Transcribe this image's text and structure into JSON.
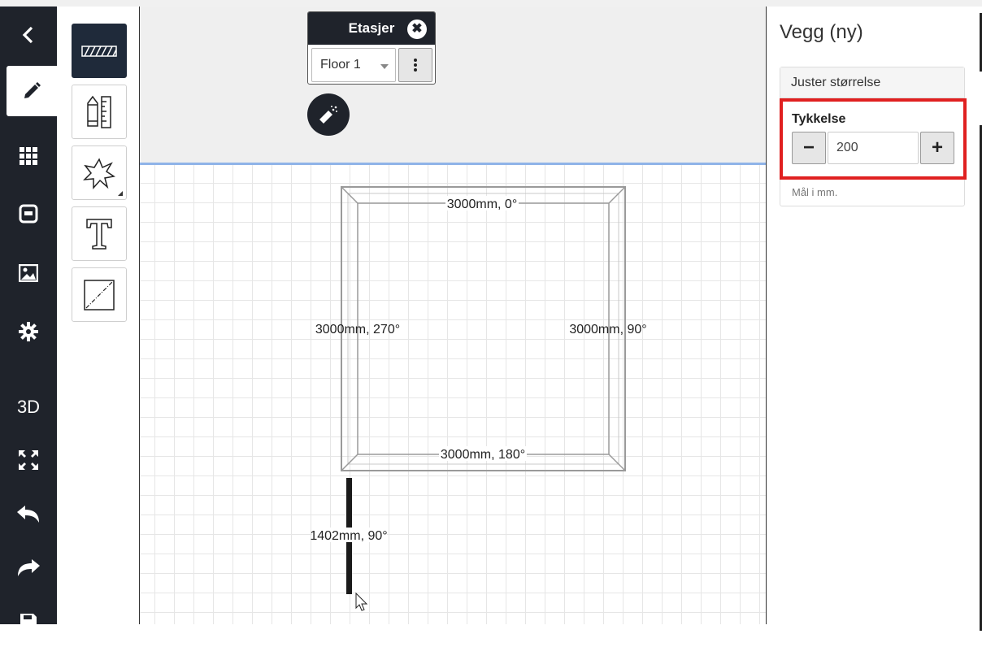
{
  "nav": {
    "items": [
      {
        "name": "back",
        "icon": "chevron-left-icon"
      },
      {
        "name": "draw",
        "icon": "pencil-icon"
      },
      {
        "name": "grid",
        "icon": "grid-icon"
      },
      {
        "name": "object",
        "icon": "square-icon"
      },
      {
        "name": "image",
        "icon": "image-icon"
      },
      {
        "name": "settings",
        "icon": "gear-icon"
      },
      {
        "name": "3d",
        "label": "3D"
      },
      {
        "name": "fullscreen",
        "icon": "expand-icon"
      },
      {
        "name": "undo",
        "icon": "undo-icon"
      },
      {
        "name": "redo",
        "icon": "redo-icon"
      },
      {
        "name": "save",
        "icon": "save-icon"
      }
    ]
  },
  "tools": [
    {
      "name": "wall-tool",
      "icon": "wall-icon",
      "selected": true
    },
    {
      "name": "measure-tool",
      "icon": "pencil-ruler-icon"
    },
    {
      "name": "shape-tool",
      "icon": "starburst-icon"
    },
    {
      "name": "text-tool",
      "icon": "text-icon"
    },
    {
      "name": "line-tool",
      "icon": "diagonal-line-icon"
    }
  ],
  "floors": {
    "title": "Etasjer",
    "selected": "Floor 1"
  },
  "drawing": {
    "labels": {
      "top": "3000mm, 0°",
      "right": "3000mm, 90°",
      "bottom": "3000mm, 180°",
      "left": "3000mm, 270°",
      "new_wall": "1402mm, 90°"
    }
  },
  "panel": {
    "title": "Vegg (ny)",
    "section": "Juster størrelse",
    "thickness_label": "Tykkelse",
    "thickness_value": "200",
    "minus": "−",
    "plus": "+",
    "units_note": "Mål i mm."
  },
  "colors": {
    "nav_bg": "#1f232b",
    "highlight": "#e02020",
    "canvas_border": "#8fb3e8"
  }
}
